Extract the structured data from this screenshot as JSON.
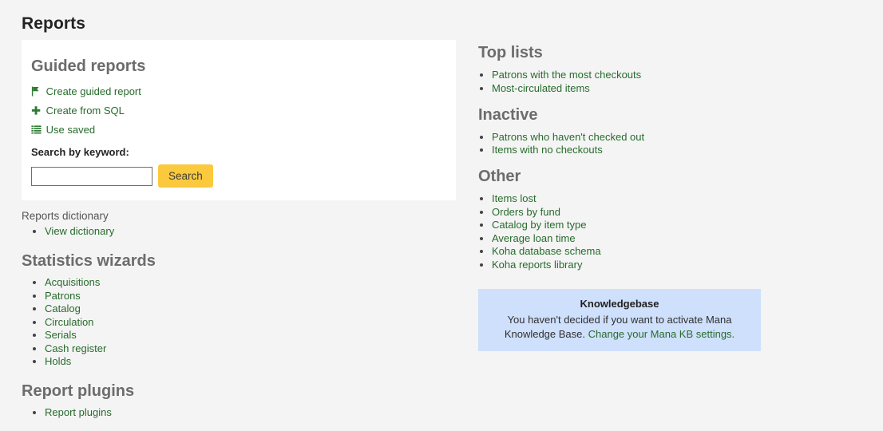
{
  "page": {
    "title": "Reports"
  },
  "guided": {
    "heading": "Guided reports",
    "actions": [
      {
        "icon": "flag-icon",
        "label": "Create guided report"
      },
      {
        "icon": "plus-icon",
        "label": "Create from SQL"
      },
      {
        "icon": "list-icon",
        "label": "Use saved"
      }
    ],
    "search_label": "Search by keyword:",
    "search_value": "",
    "search_placeholder": "",
    "search_button": "Search"
  },
  "dictionary": {
    "heading": "Reports dictionary",
    "items": [
      {
        "label": "View dictionary"
      }
    ]
  },
  "statistics": {
    "heading": "Statistics wizards",
    "items": [
      {
        "label": "Acquisitions"
      },
      {
        "label": "Patrons"
      },
      {
        "label": "Catalog"
      },
      {
        "label": "Circulation"
      },
      {
        "label": "Serials"
      },
      {
        "label": "Cash register"
      },
      {
        "label": "Holds"
      }
    ]
  },
  "plugins": {
    "heading": "Report plugins",
    "items": [
      {
        "label": "Report plugins"
      }
    ]
  },
  "top_lists": {
    "heading": "Top lists",
    "items": [
      {
        "label": "Patrons with the most checkouts"
      },
      {
        "label": "Most-circulated items"
      }
    ]
  },
  "inactive": {
    "heading": "Inactive",
    "items": [
      {
        "label": "Patrons who haven't checked out"
      },
      {
        "label": "Items with no checkouts"
      }
    ]
  },
  "other": {
    "heading": "Other",
    "items": [
      {
        "label": "Items lost"
      },
      {
        "label": "Orders by fund"
      },
      {
        "label": "Catalog by item type"
      },
      {
        "label": "Average loan time"
      },
      {
        "label": "Koha database schema"
      },
      {
        "label": "Koha reports library"
      }
    ]
  },
  "knowledgebase": {
    "title": "Knowledgebase",
    "text": "You haven't decided if you want to activate Mana Knowledge Base. ",
    "link": "Change your Mana KB settings."
  },
  "colors": {
    "page_background": "#f4f4f4",
    "card_background": "#ffffff",
    "link": "#276b2c",
    "heading": "#6c6c6c",
    "button": "#fbc93e",
    "info_box": "#cfe0fc"
  }
}
